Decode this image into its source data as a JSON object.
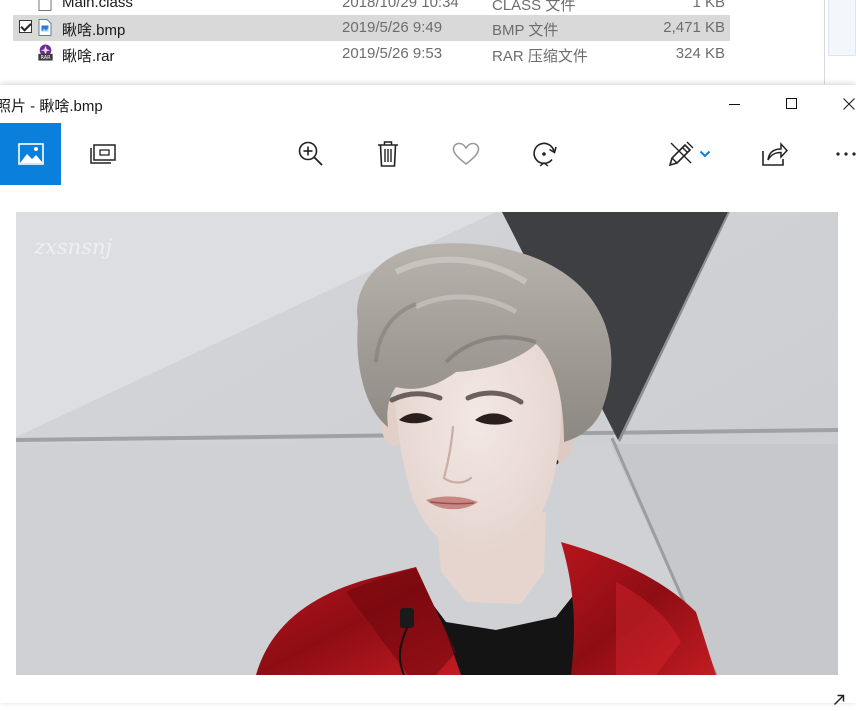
{
  "explorer": {
    "files": [
      {
        "name": "Main.class",
        "date": "2018/10/29 10:34",
        "type": "CLASS 文件",
        "size": "1 KB",
        "icon": "file-icon",
        "selected": false
      },
      {
        "name": "瞅啥.bmp",
        "date": "2019/5/26 9:49",
        "type": "BMP 文件",
        "size": "2,471 KB",
        "icon": "bmp-file-icon",
        "selected": true
      },
      {
        "name": "瞅啥.rar",
        "date": "2019/5/26 9:53",
        "type": "RAR 压缩文件",
        "size": "324 KB",
        "icon": "rar-file-icon",
        "selected": false
      }
    ]
  },
  "photos": {
    "title": "照片 - 瞅啥.bmp",
    "accent": "#0a7fdc",
    "toolbar": {
      "icons": [
        "photo-collection-icon",
        "slideshow-icon",
        "zoom-in-icon",
        "delete-icon",
        "favorite-heart-icon",
        "rotate-icon",
        "edit-create-icon",
        "chevron-down-icon",
        "share-icon",
        "more-icon"
      ]
    },
    "image": {
      "watermark": "zxsnsnj",
      "jacket_color": "#a8121a",
      "background_color": "#d8dadd"
    }
  }
}
